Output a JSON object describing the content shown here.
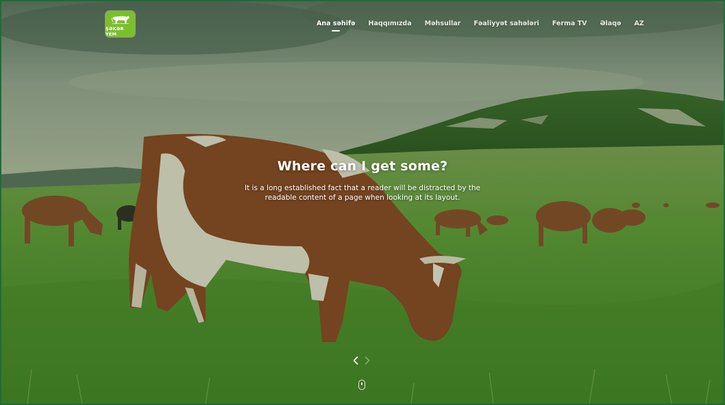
{
  "brand": {
    "logo_text": "ŞƏKƏR YEM",
    "logo_color": "#7bbf2a"
  },
  "nav": {
    "items": [
      {
        "label": "Ana səhifə",
        "active": true
      },
      {
        "label": "Haqqımızda",
        "active": false
      },
      {
        "label": "Məhsullar",
        "active": false
      },
      {
        "label": "Fəaliyyət sahələri",
        "active": false
      },
      {
        "label": "Ferma TV",
        "active": false
      },
      {
        "label": "Əlaqə",
        "active": false
      },
      {
        "label": "AZ",
        "active": false
      }
    ]
  },
  "slide": {
    "title": "Where can I get some?",
    "text": "It is a long established fact that a reader will be distracted by the readable content of a page when looking at its layout."
  },
  "controls": {
    "prev_icon": "chevron-left-icon",
    "next_icon": "chevron-right-icon",
    "scroll_icon": "mouse-scroll-icon"
  },
  "colors": {
    "text": "#ffffff",
    "frame": "#1f6b3a"
  }
}
